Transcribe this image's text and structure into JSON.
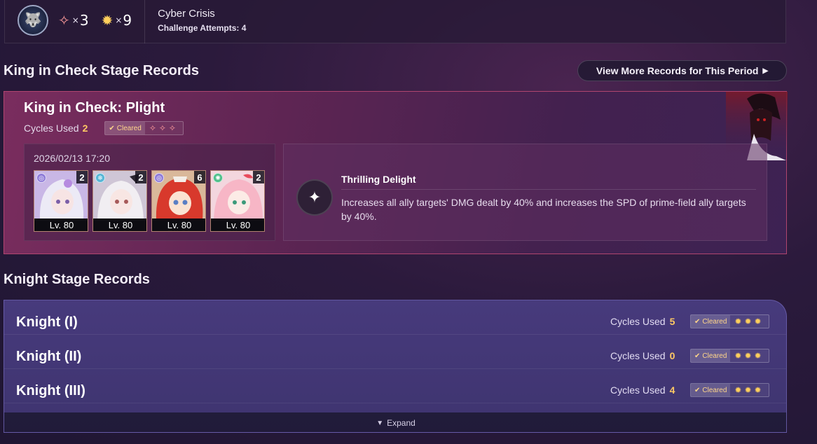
{
  "summary": {
    "emblem_icon": "wolf-emblem-icon",
    "stars": [
      {
        "icon": "pink-star-icon",
        "symbol": "✧",
        "prefix": "×",
        "count": "3"
      },
      {
        "icon": "gold-star-icon",
        "symbol": "✹",
        "prefix": "×",
        "count": "9"
      }
    ],
    "mode_name": "Cyber Crisis",
    "attempts": "Challenge Attempts: 4"
  },
  "king_section": {
    "title": "King in Check Stage Records",
    "view_more": "View More Records for This Period",
    "card": {
      "title": "King in Check: Plight",
      "cycles_label": "Cycles Used",
      "cycles_value": "2",
      "cleared_label": "Cleared",
      "stars": "✧✧✧",
      "date": "2026/02/13 17:20",
      "characters": [
        {
          "element_icon": "imaginary-element-icon",
          "eidolon": "2",
          "level": "Lv. 80",
          "element_color": "#8f7bd8"
        },
        {
          "element_icon": "ice-element-icon",
          "eidolon": "2",
          "level": "Lv. 80",
          "element_color": "#57b6d6"
        },
        {
          "element_icon": "imaginary-element-icon",
          "eidolon": "6",
          "level": "Lv. 80",
          "element_color": "#8f7bd8"
        },
        {
          "element_icon": "wind-element-icon",
          "eidolon": "2",
          "level": "Lv. 80",
          "element_color": "#4fbf8a"
        }
      ],
      "buff_title": "Thrilling Delight",
      "buff_description": "Increases all ally targets' DMG dealt by 40% and increases the SPD of prime-field ally targets by 40%."
    }
  },
  "knight_section": {
    "title": "Knight Stage Records",
    "rows": [
      {
        "name": "Knight (I)",
        "cycles_label": "Cycles Used",
        "cycles_value": "5",
        "cleared_label": "Cleared",
        "stars": "✹✹✹"
      },
      {
        "name": "Knight (II)",
        "cycles_label": "Cycles Used",
        "cycles_value": "0",
        "cleared_label": "Cleared",
        "stars": "✹✹✹"
      },
      {
        "name": "Knight (III)",
        "cycles_label": "Cycles Used",
        "cycles_value": "4",
        "cleared_label": "Cleared",
        "stars": "✹✹✹"
      }
    ],
    "expand_label": "Expand"
  },
  "colors": {
    "pink_star": "#ff9b9b",
    "gold_star": "#ffcf5c",
    "highlight": "#ffc964"
  }
}
